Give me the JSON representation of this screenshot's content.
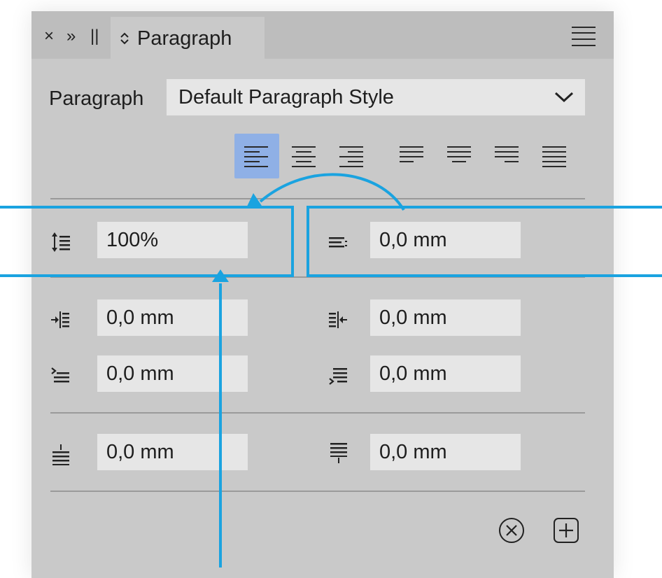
{
  "panel": {
    "controls": {
      "close": "×",
      "collapse": "»",
      "grip": "||"
    },
    "tab_label": "Paragraph",
    "menu_icon": "hamburger-menu-icon"
  },
  "style_row": {
    "label": "Paragraph",
    "value": "Default Paragraph Style"
  },
  "alignment": {
    "buttons": [
      "align-left",
      "align-center",
      "align-right",
      "justify-left",
      "justify-center",
      "justify-right",
      "justify-all"
    ],
    "active": "align-left",
    "active_color": "#8fb0e6"
  },
  "spacing": {
    "leading": "100%",
    "paragraph_space": "0,0 mm"
  },
  "indents": {
    "left_indent": "0,0 mm",
    "right_indent": "0,0 mm",
    "first_line_indent": "0,0 mm",
    "last_line_indent": "0,0 mm"
  },
  "before_after": {
    "space_before": "0,0 mm",
    "space_after": "0,0 mm"
  },
  "footer": {
    "clear_icon": "circle-x-icon",
    "add_icon": "square-plus-icon"
  },
  "annotation": {
    "color": "#1aa3e0"
  }
}
